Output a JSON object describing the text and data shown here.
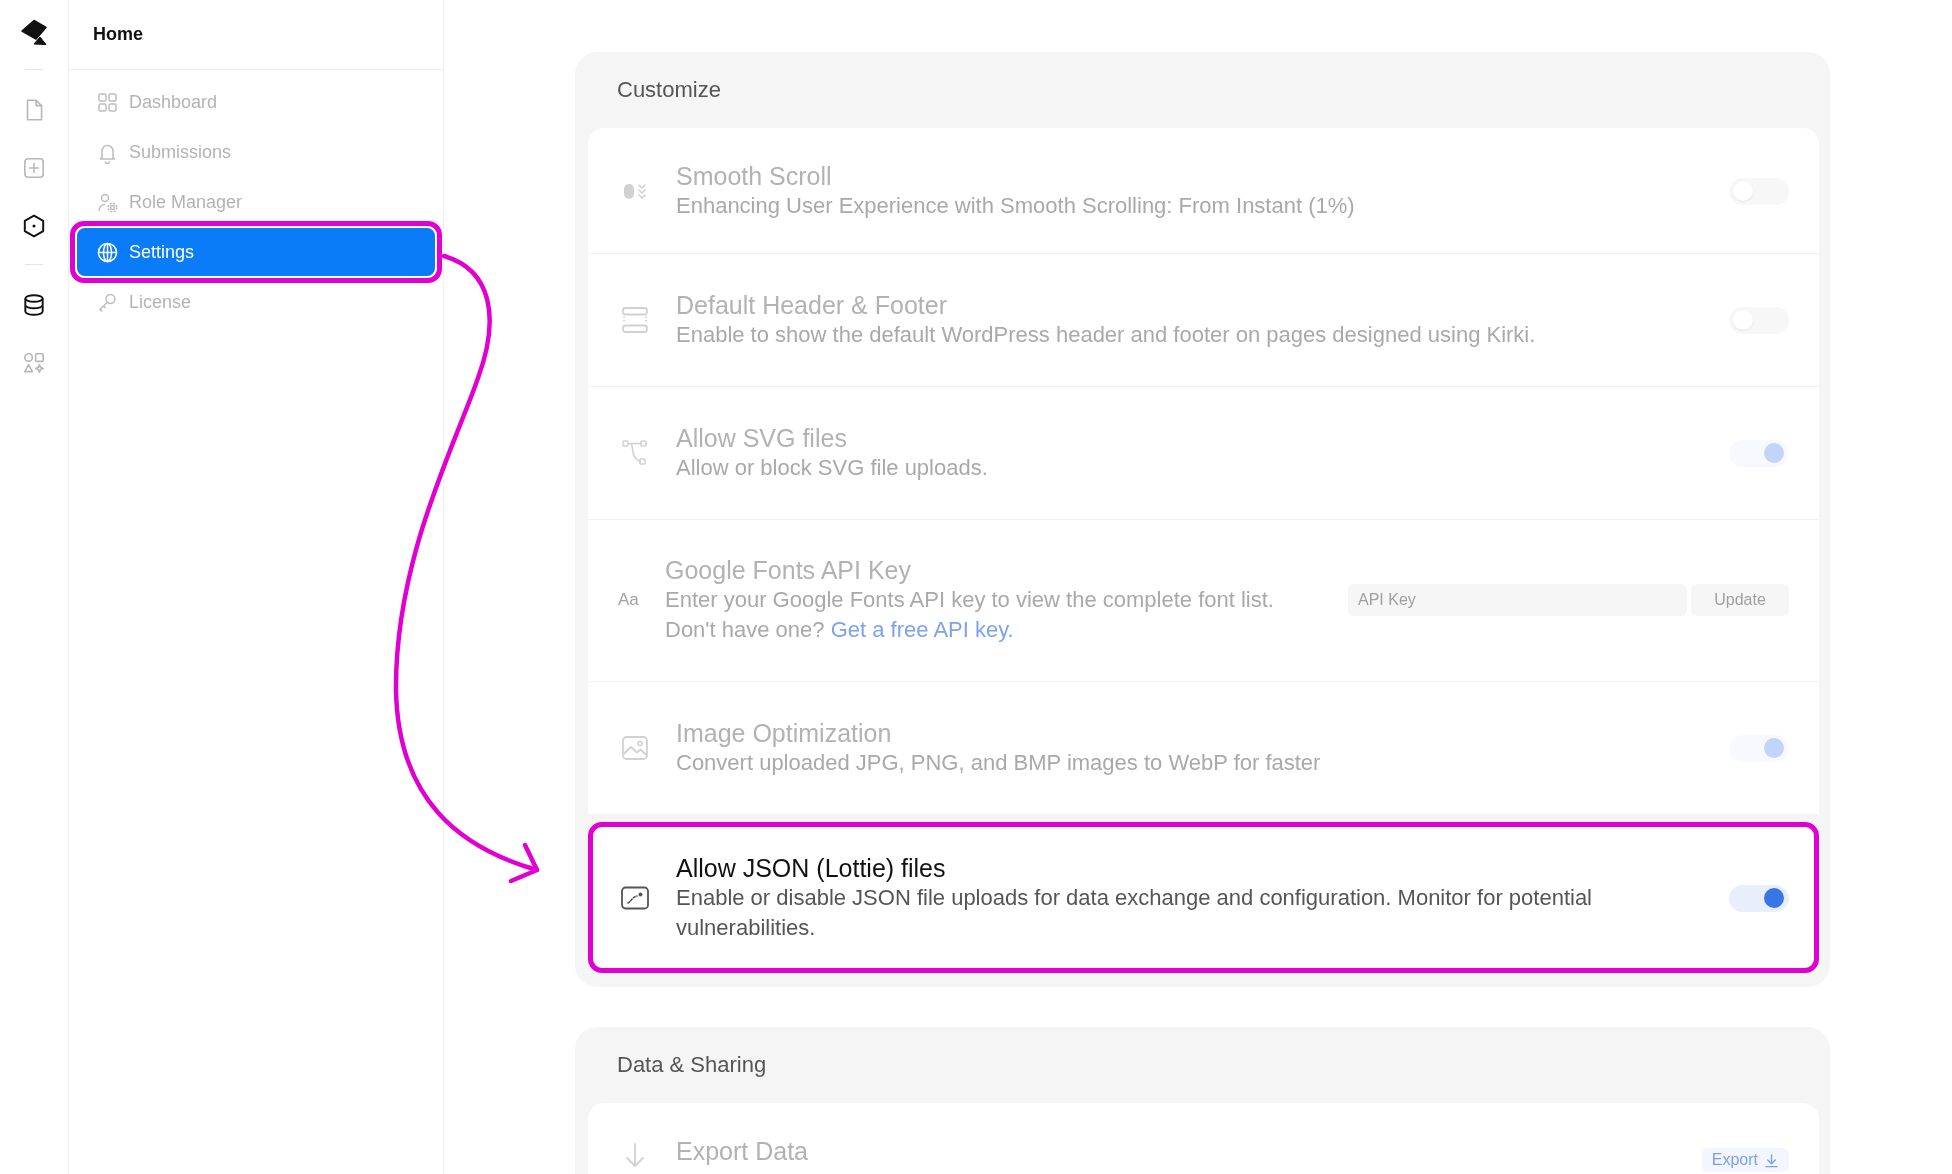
{
  "sidebar": {
    "title": "Home",
    "items": [
      {
        "label": "Dashboard",
        "selected": false,
        "highlighted": false
      },
      {
        "label": "Submissions",
        "selected": false,
        "highlighted": false
      },
      {
        "label": "Role Manager",
        "selected": false,
        "highlighted": false
      },
      {
        "label": "Settings",
        "selected": true,
        "highlighted": true
      },
      {
        "label": "License",
        "selected": false,
        "highlighted": false
      }
    ]
  },
  "sections": [
    {
      "title": "Customize",
      "rows": [
        {
          "kind": "toggle",
          "title": "Smooth Scroll",
          "description": "Enhancing User Experience with Smooth Scrolling: From Instant (1%)",
          "on": false,
          "highlighted": false
        },
        {
          "kind": "toggle",
          "title": "Default Header & Footer",
          "description": "Enable to show the default WordPress header and footer on pages designed using Kirki.",
          "on": false,
          "highlighted": false
        },
        {
          "kind": "toggle",
          "title": "Allow SVG files",
          "description": "Allow or block SVG file uploads.",
          "on": true,
          "highlighted": false
        },
        {
          "kind": "api_key",
          "glyph": "Aa",
          "title": "Google Fonts API Key",
          "description": "Enter your Google Fonts API key to view the complete font list.",
          "note": "Don't have one?",
          "link": "Get a free API key.",
          "field": {
            "placeholder": "API Key"
          },
          "button": "Update",
          "highlighted": false
        },
        {
          "kind": "toggle",
          "title": "Image Optimization",
          "description": "Convert uploaded JPG, PNG, and BMP images to WebP for faster",
          "on": true,
          "highlighted": false
        },
        {
          "kind": "toggle",
          "title": "Allow JSON (Lottie) files",
          "description": "Enable or disable JSON file uploads for data exchange and configuration. Monitor for potential vulnerabilities.",
          "on": true,
          "highlighted": true
        }
      ]
    },
    {
      "title": "Data & Sharing",
      "rows": [
        {
          "kind": "action",
          "title": "Export Data",
          "button": "Export",
          "highlighted": false
        }
      ]
    }
  ]
}
